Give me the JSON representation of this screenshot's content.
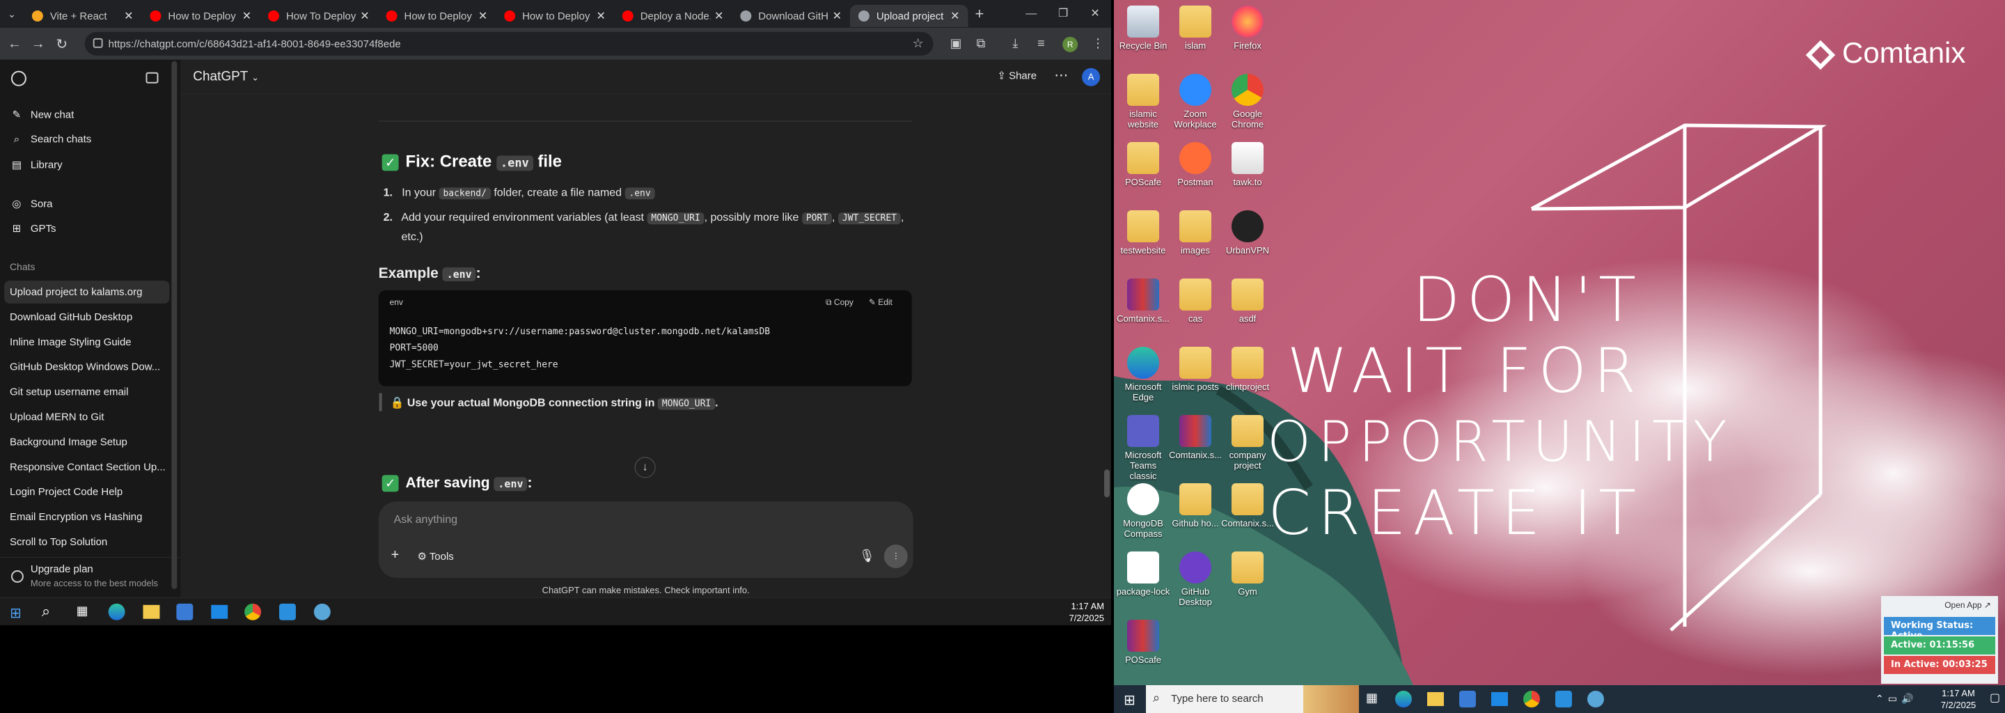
{
  "browser": {
    "tabs": [
      {
        "title": "Vite + React",
        "color": "#f5a623"
      },
      {
        "title": "How to Deploy Re",
        "color": "#ff0000"
      },
      {
        "title": "How To Deploy M",
        "color": "#ff0000"
      },
      {
        "title": "How to Deploy a F",
        "color": "#ff0000"
      },
      {
        "title": "How to Deploy M",
        "color": "#ff0000"
      },
      {
        "title": "Deploy a Node.js",
        "color": "#ff0000"
      },
      {
        "title": "Download GitHub",
        "color": "#9aa0a6"
      },
      {
        "title": "Upload project to",
        "color": "#9aa0a6"
      }
    ],
    "url": "https://chatgpt.com/c/68643d21-af14-8001-8649-ee33074f8ede",
    "profile_letter": "R"
  },
  "sidebar": {
    "new_chat": "New chat",
    "search_chats": "Search chats",
    "library": "Library",
    "sora": "Sora",
    "gpts": "GPTs",
    "chats_heading": "Chats",
    "chats": [
      "Upload project to kalams.org",
      "Download GitHub Desktop",
      "Inline Image Styling Guide",
      "GitHub Desktop Windows Dow...",
      "Git setup username email",
      "Upload MERN to Git",
      "Background Image Setup",
      "Responsive Contact Section Up...",
      "Login Project Code Help",
      "Email Encryption vs Hashing",
      "Scroll to Top Solution"
    ],
    "upgrade_title": "Upgrade plan",
    "upgrade_sub": "More access to the best models"
  },
  "header": {
    "model": "ChatGPT",
    "share": "Share",
    "avatar": "A"
  },
  "message": {
    "fix_title_pre": "Fix: Create",
    "fix_title_code": ".env",
    "fix_title_post": "file",
    "step1_pre": "In your",
    "step1_code1": "backend/",
    "step1_mid": "folder, create a file named",
    "step1_code2": ".env",
    "step2_pre": "Add your required environment variables (at least",
    "step2_code1": "MONGO_URI",
    "step2_mid": ", possibly more like",
    "step2_code2": "PORT",
    "step2_code3": "JWT_SECRET",
    "step2_post": ",",
    "step2_line2": "etc.)",
    "example_pre": "Example",
    "example_code": ".env",
    "example_post": ":",
    "code_lang": "env",
    "copy": "Copy",
    "edit": "Edit",
    "code_lines": [
      "MONGO_URI=mongodb+srv://username:password@cluster.mongodb.net/kalamsDB",
      "PORT=5000",
      "JWT_SECRET=your_jwt_secret_here"
    ],
    "tip_pre": "Use your actual MongoDB connection string in",
    "tip_code": "MONGO_URI",
    "tip_post": ".",
    "after_pre": "After saving",
    "after_code": ".env",
    "after_post": ":"
  },
  "composer": {
    "placeholder": "Ask anything",
    "tools": "Tools",
    "disclaimer": "ChatGPT can make mistakes. Check important info."
  },
  "taskbar_left": {
    "time": "1:17 AM",
    "date": "7/2/2025"
  },
  "desktop": {
    "brand": "Comtanix",
    "quote": [
      "DON'T",
      "WAIT FOR",
      "OPPORTUNITY",
      "CREATE IT"
    ],
    "icons": [
      {
        "label": "Recycle Bin",
        "kind": "bin"
      },
      {
        "label": "islam",
        "kind": "folder"
      },
      {
        "label": "Firefox",
        "kind": "firefox"
      },
      {
        "label": "islamic website",
        "kind": "folder"
      },
      {
        "label": "Zoom Workplace",
        "kind": "zoom"
      },
      {
        "label": "Google Chrome",
        "kind": "chrome"
      },
      {
        "label": "POScafe",
        "kind": "folder"
      },
      {
        "label": "Postman",
        "kind": "postman"
      },
      {
        "label": "tawk.to",
        "kind": "file"
      },
      {
        "label": "testwebsite",
        "kind": "folder"
      },
      {
        "label": "images",
        "kind": "folder"
      },
      {
        "label": "UrbanVPN",
        "kind": "vpn"
      },
      {
        "label": "Comtanix.s...",
        "kind": "rar"
      },
      {
        "label": "cas",
        "kind": "folder"
      },
      {
        "label": "asdf",
        "kind": "folder"
      },
      {
        "label": "Microsoft Edge",
        "kind": "edge"
      },
      {
        "label": "islmic posts",
        "kind": "folder"
      },
      {
        "label": "clintproject",
        "kind": "folder"
      },
      {
        "label": "Microsoft Teams classic",
        "kind": "teams"
      },
      {
        "label": "Comtanix.s...",
        "kind": "rar"
      },
      {
        "label": "company project",
        "kind": "folder"
      },
      {
        "label": "MongoDB Compass",
        "kind": "mongo"
      },
      {
        "label": "Github ho...",
        "kind": "folder"
      },
      {
        "label": "Comtanix.s...",
        "kind": "folder"
      },
      {
        "label": "package-lock",
        "kind": "json"
      },
      {
        "label": "GitHub Desktop",
        "kind": "github"
      },
      {
        "label": "Gym",
        "kind": "folder"
      },
      {
        "label": "POScafe",
        "kind": "rar"
      }
    ],
    "status_widget": {
      "open_app": "Open App ↗",
      "working": "Working Status: Active",
      "active": "Active: 01:15:56",
      "inactive": "In Active: 00:03:25"
    },
    "search_placeholder": "Type here to search",
    "time": "1:17 AM",
    "date": "7/2/2025"
  }
}
